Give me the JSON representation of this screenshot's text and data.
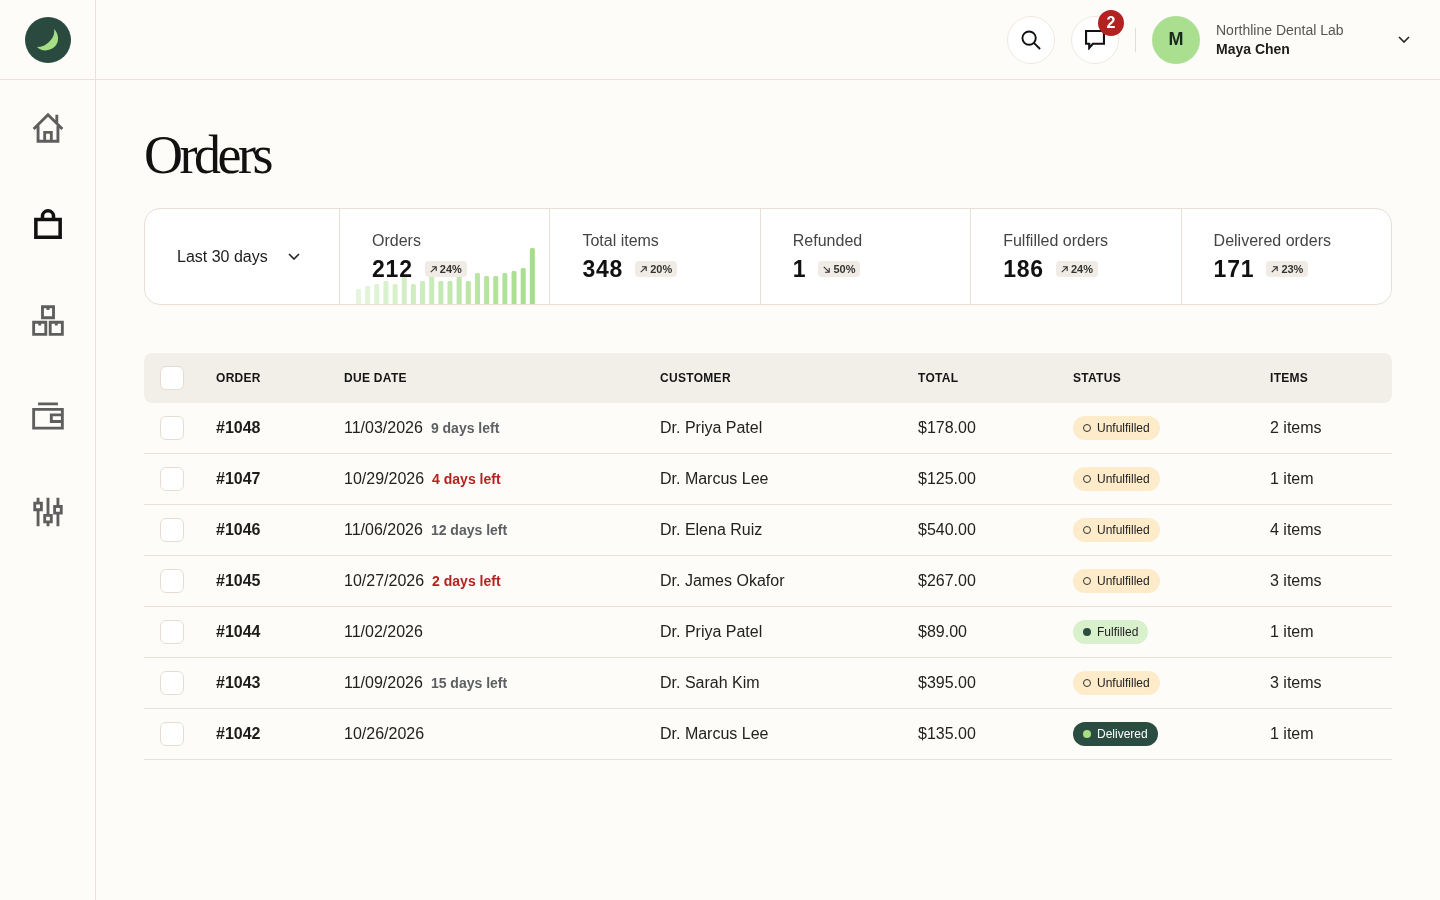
{
  "sidebar": {
    "items": [
      {
        "kind": "home",
        "selected": false
      },
      {
        "kind": "bag",
        "selected": true
      },
      {
        "kind": "boxes",
        "selected": false
      },
      {
        "kind": "wallet",
        "selected": false
      },
      {
        "kind": "sliders",
        "selected": false
      }
    ]
  },
  "header": {
    "notifications": {
      "count": "2"
    },
    "account": {
      "initial": "M",
      "organization": "Northline Dental Lab",
      "name": "Maya Chen"
    }
  },
  "page": {
    "title": "Orders"
  },
  "summary": {
    "period": {
      "value": "Last 30 days"
    },
    "metrics": [
      {
        "label": "Orders",
        "value": "212",
        "change": {
          "kind": "up",
          "value": "24%"
        },
        "sparkline": true
      },
      {
        "label": "Total items",
        "value": "348",
        "change": {
          "kind": "up",
          "value": "20%"
        }
      },
      {
        "label": "Refunded",
        "value": "1",
        "change": {
          "kind": "down",
          "value": "50%"
        }
      },
      {
        "label": "Fulfilled orders",
        "value": "186",
        "change": {
          "kind": "up",
          "value": "24%"
        }
      },
      {
        "label": "Delivered orders",
        "value": "171",
        "change": {
          "kind": "up",
          "value": "23%"
        }
      }
    ]
  },
  "table": {
    "select_all": {
      "checked": false
    },
    "columns": [
      "ORDER",
      "DUE DATE",
      "CUSTOMER",
      "TOTAL",
      "STATUS",
      "ITEMS"
    ],
    "rows": [
      {
        "selected": false,
        "order": "#1048",
        "due_date": "11/03/2026",
        "days_left": "9 days left",
        "urgent": false,
        "customer": "Dr. Priya Patel",
        "total": "$178.00",
        "status": {
          "kind": "unfulfilled",
          "label": "Unfulfilled"
        },
        "items": "2 items"
      },
      {
        "selected": false,
        "order": "#1047",
        "due_date": "10/29/2026",
        "days_left": "4 days left",
        "urgent": true,
        "customer": "Dr. Marcus Lee",
        "total": "$125.00",
        "status": {
          "kind": "unfulfilled",
          "label": "Unfulfilled"
        },
        "items": "1 item"
      },
      {
        "selected": false,
        "order": "#1046",
        "due_date": "11/06/2026",
        "days_left": "12 days left",
        "urgent": false,
        "customer": "Dr. Elena Ruiz",
        "total": "$540.00",
        "status": {
          "kind": "unfulfilled",
          "label": "Unfulfilled"
        },
        "items": "4 items"
      },
      {
        "selected": false,
        "order": "#1045",
        "due_date": "10/27/2026",
        "days_left": "2 days left",
        "urgent": true,
        "customer": "Dr. James Okafor",
        "total": "$267.00",
        "status": {
          "kind": "unfulfilled",
          "label": "Unfulfilled"
        },
        "items": "3 items"
      },
      {
        "selected": false,
        "order": "#1044",
        "due_date": "11/02/2026",
        "customer": "Dr. Priya Patel",
        "total": "$89.00",
        "status": {
          "kind": "fulfilled",
          "label": "Fulfilled"
        },
        "items": "1 item"
      },
      {
        "selected": false,
        "order": "#1043",
        "due_date": "11/09/2026",
        "days_left": "15 days left",
        "urgent": false,
        "customer": "Dr. Sarah Kim",
        "total": "$395.00",
        "status": {
          "kind": "unfulfilled",
          "label": "Unfulfilled"
        },
        "items": "3 items"
      },
      {
        "selected": false,
        "order": "#1042",
        "due_date": "10/26/2026",
        "customer": "Dr. Marcus Lee",
        "total": "$135.00",
        "status": {
          "kind": "delivered",
          "label": "Delivered"
        },
        "items": "1 item"
      }
    ]
  }
}
